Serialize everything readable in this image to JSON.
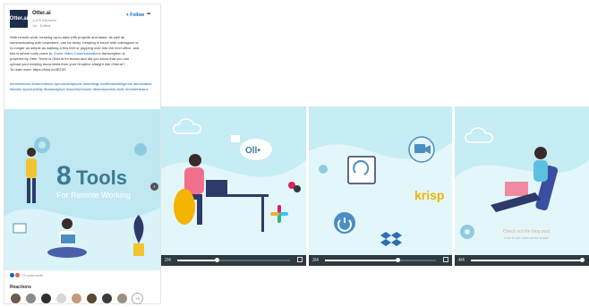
{
  "post": {
    "logo_text": "Otter.ai",
    "author": "Otter.ai",
    "followers": "1,470 followers",
    "timestamp": "1w · Edited",
    "follow_label": "+ Follow",
    "more_label": "•••",
    "body_lines": [
      "With remote work, keeping up-to-date with projects and tasks, as well as",
      "communicating with coworkers, can be tricky. Keeping in touch with colleagues is",
      "no longer as simple as walking a few feet or popping over into the next office, and",
      "this is where tools come in.",
      "powered by Otter There is Otter.ai for teams and did you know that you can",
      "upload your existing documents from your Dropbox straight into Otter.ai?",
      "To read more: https://lnkd.in/dEZ3S"
    ],
    "body_link_1": "Zoom Video Communications",
    "body_after_link_1": " transcription is",
    "hashtags": "#remotework #futureofwork #productivitytools #meetings #artificialintelligence #innovation #teams #productivity #transcription #workfromhome #teamsuccess #wfh #remoteteams",
    "footer_count": "73 comments",
    "reactions_title": "Reactions",
    "more_reactors": "+3"
  },
  "slides": [
    {
      "counter": "2/4",
      "progress": 0.35
    },
    {
      "counter": "3/4",
      "progress": 0.65
    },
    {
      "counter": "4/4",
      "progress": 1.0
    }
  ],
  "hero": {
    "big_number": "8",
    "big_word": "Tools",
    "subtitle": "For Remote Working"
  },
  "slide1": {
    "bubble_text": "Oll•"
  },
  "slide2": {
    "brand": "krisp"
  },
  "slide3": {
    "blog_line1": "Check out the blog post",
    "blog_line2": "Link in our comments below"
  },
  "colors": {
    "bg_blue": "#c6ecf4",
    "accent_blue": "#3c7a93",
    "controls": "#2d3a40",
    "link": "#0a66c2"
  }
}
